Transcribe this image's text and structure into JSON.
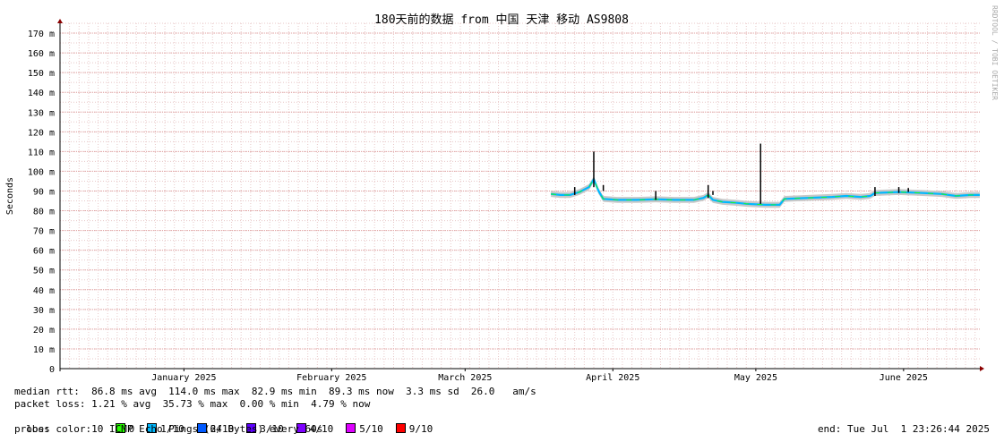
{
  "chart_data": {
    "type": "line",
    "title": "180天前的数据 from 中国 天津 移动 AS9808",
    "ylabel": "Seconds",
    "xlabel": "",
    "ylim": [
      0,
      175
    ],
    "yunit": "m",
    "yticks": [
      0,
      10,
      20,
      30,
      40,
      50,
      60,
      70,
      80,
      90,
      100,
      110,
      120,
      130,
      140,
      150,
      160,
      170
    ],
    "xlim": [
      "2024-12-20",
      "2025-07-01"
    ],
    "xticks": [
      {
        "date": "2025-01-15",
        "label": "January 2025"
      },
      {
        "date": "2025-02-15",
        "label": "February 2025"
      },
      {
        "date": "2025-03-15",
        "label": "March 2025"
      },
      {
        "date": "2025-04-15",
        "label": "April 2025"
      },
      {
        "date": "2025-05-15",
        "label": "May 2025"
      },
      {
        "date": "2025-06-15",
        "label": "June 2025"
      }
    ],
    "grid": true,
    "watermark": "RRDTOOL / TOBI OETIKER",
    "series": [
      {
        "values": [
          [
            "2025-04-02",
            88.5
          ],
          [
            "2025-04-04",
            88.0
          ],
          [
            "2025-04-06",
            88.0
          ],
          [
            "2025-04-08",
            89.5
          ],
          [
            "2025-04-10",
            92.0
          ],
          [
            "2025-04-11",
            96.0
          ],
          [
            "2025-04-12",
            90.0
          ],
          [
            "2025-04-13",
            86.0
          ],
          [
            "2025-04-16",
            85.5
          ],
          [
            "2025-04-20",
            85.5
          ],
          [
            "2025-04-24",
            85.8
          ],
          [
            "2025-04-28",
            85.5
          ],
          [
            "2025-05-02",
            85.5
          ],
          [
            "2025-05-04",
            86.5
          ],
          [
            "2025-05-05",
            88.0
          ],
          [
            "2025-05-06",
            85.5
          ],
          [
            "2025-05-08",
            84.5
          ],
          [
            "2025-05-11",
            84.0
          ],
          [
            "2025-05-13",
            83.5
          ],
          [
            "2025-05-17",
            83.0
          ],
          [
            "2025-05-20",
            83.0
          ],
          [
            "2025-05-21",
            86.0
          ],
          [
            "2025-05-26",
            86.5
          ],
          [
            "2025-05-31",
            87.0
          ],
          [
            "2025-06-03",
            87.5
          ],
          [
            "2025-06-06",
            87.0
          ],
          [
            "2025-06-08",
            87.5
          ],
          [
            "2025-06-09",
            89.0
          ],
          [
            "2025-06-14",
            89.5
          ],
          [
            "2025-06-19",
            89.0
          ],
          [
            "2025-06-23",
            88.5
          ],
          [
            "2025-06-26",
            87.5
          ],
          [
            "2025-06-29",
            88.0
          ],
          [
            "2025-07-01",
            88.0
          ]
        ]
      }
    ],
    "spikes": [
      [
        "2025-04-07",
        92.0
      ],
      [
        "2025-04-11",
        110.0
      ],
      [
        "2025-04-13",
        93.0
      ],
      [
        "2025-04-24",
        90.0
      ],
      [
        "2025-05-05",
        93.0
      ],
      [
        "2025-05-06",
        90.0
      ],
      [
        "2025-05-16",
        114.0
      ],
      [
        "2025-06-09",
        92.0
      ],
      [
        "2025-06-14",
        92.0
      ],
      [
        "2025-06-16",
        91.5
      ]
    ],
    "smoke_band": 1.5
  },
  "stats": {
    "median_rtt": "median rtt:  86.8 ms avg  114.0 ms max  82.9 ms min  89.3 ms now  3.3 ms sd  26.0   am/s",
    "packet_loss": "packet loss: 1.21 % avg  35.73 % max  0.00 % min  4.79 % now",
    "loss_label": "loss color:",
    "loss_colors": [
      {
        "label": "0",
        "color": "#26ff00"
      },
      {
        "label": "1/10",
        "color": "#00b8ff"
      },
      {
        "label": "2/10",
        "color": "#0059ff"
      },
      {
        "label": "3/10",
        "color": "#5e00ff"
      },
      {
        "label": "4/10",
        "color": "#7e00ff"
      },
      {
        "label": "5/10",
        "color": "#dd00ff"
      },
      {
        "label": "9/10",
        "color": "#ff0000"
      }
    ],
    "probe": "probe:       10 ICMP Echo Pings (64 Bytes) every 60s",
    "end": "end: Tue Jul  1 23:26:44 2025"
  }
}
